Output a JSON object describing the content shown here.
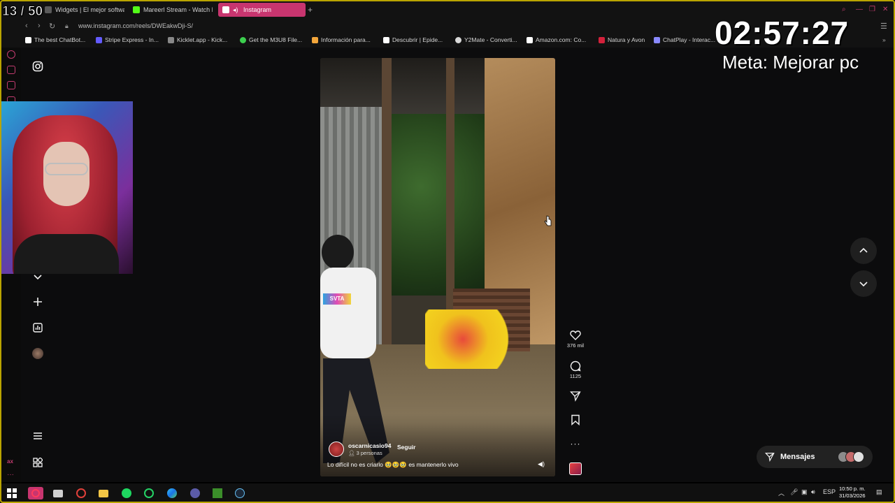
{
  "overlay": {
    "counter": "13 / 50",
    "timer": "02:57:27",
    "goal": "Meta: Mejorar pc"
  },
  "browser": {
    "tabs": [
      {
        "label": "Widgets | El mejor software",
        "color": "#5a5a5a"
      },
      {
        "label": "Mareerl Stream - Watch Live",
        "color": "#53fc18"
      },
      {
        "label": "Instagram",
        "color": "#e1306c"
      }
    ],
    "url": "www.instagram.com/reels/DWEakwDji-S/",
    "bookmarks": [
      {
        "label": "The best ChatBot...",
        "color": "#ffffff"
      },
      {
        "label": "Stripe Express - In...",
        "color": "#635bff"
      },
      {
        "label": "Kicklet.app - Kick...",
        "color": "#888888"
      },
      {
        "label": "Get the M3U8 File...",
        "color": "#3ccf4e"
      },
      {
        "label": "Información para...",
        "color": "#f3a63b"
      },
      {
        "label": "Descubrir | Epide...",
        "color": "#ffffff"
      },
      {
        "label": "Y2Mate - Converti...",
        "color": "#d9d9d9"
      },
      {
        "label": "Amazon.com: Co...",
        "color": "#ffffff"
      },
      {
        "label": "Natura y Avon",
        "color": "#d3213b"
      },
      {
        "label": "ChatPlay - Interac...",
        "color": "#8a8aff"
      }
    ]
  },
  "reel": {
    "username": "oscarnicasio94",
    "follow_label": "Seguir",
    "people": "3 personas",
    "caption": "Lo difícil no es criarlo 🥹🥹🥹 es mantenerlo vivo",
    "shirt_text": "SVTA",
    "likes": "376 mil",
    "comments": "1125"
  },
  "messages": {
    "label": "Mensajes"
  },
  "taskbar": {
    "language": "ESP",
    "time": "10:50 p. m.",
    "date": "31/03/2026"
  }
}
